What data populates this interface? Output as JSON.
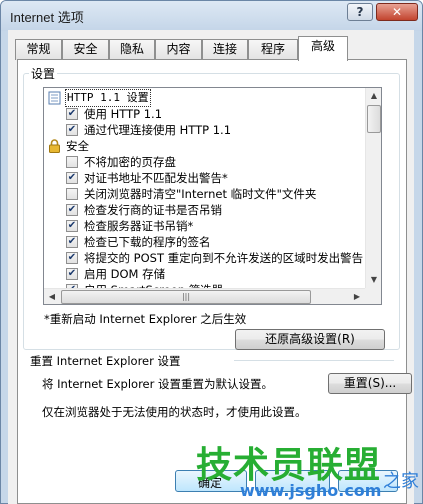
{
  "window": {
    "title": "Internet 选项",
    "help_label": "?",
    "close_label": "✕"
  },
  "tabs": [
    {
      "label": "常规"
    },
    {
      "label": "安全"
    },
    {
      "label": "隐私"
    },
    {
      "label": "内容"
    },
    {
      "label": "连接"
    },
    {
      "label": "程序"
    },
    {
      "label": "高级",
      "active": true
    }
  ],
  "settings": {
    "group_label": "设置",
    "items": [
      {
        "text": "HTTP 1.1 设置",
        "kind": "header-icon",
        "selected": true
      },
      {
        "text": "使用 HTTP 1.1",
        "kind": "checkbox",
        "checked": true
      },
      {
        "text": "通过代理连接使用 HTTP 1.1",
        "kind": "checkbox",
        "checked": true
      },
      {
        "text": "安全",
        "kind": "category-lock"
      },
      {
        "text": "不将加密的页存盘",
        "kind": "checkbox",
        "checked": false
      },
      {
        "text": "对证书地址不匹配发出警告*",
        "kind": "checkbox",
        "checked": true
      },
      {
        "text": "关闭浏览器时清空\"Internet 临时文件\"文件夹",
        "kind": "checkbox",
        "checked": false
      },
      {
        "text": "检查发行商的证书是否吊销",
        "kind": "checkbox",
        "checked": true
      },
      {
        "text": "检查服务器证书吊销*",
        "kind": "checkbox",
        "checked": true
      },
      {
        "text": "检查已下载的程序的签名",
        "kind": "checkbox",
        "checked": true
      },
      {
        "text": "将提交的 POST 重定向到不允许发送的区域时发出警告",
        "kind": "checkbox",
        "checked": true
      },
      {
        "text": "启用 DOM 存储",
        "kind": "checkbox",
        "checked": true
      },
      {
        "text": "启用 SmartScreen 筛选器",
        "kind": "checkbox",
        "checked": true
      }
    ],
    "restart_note": "*重新启动 Internet Explorer 之后生效",
    "restore_button": "还原高级设置(R)"
  },
  "reset": {
    "heading": "重置 Internet Explorer 设置",
    "description": "将 Internet Explorer 设置重置为默认设置。",
    "button": "重置(S)...",
    "note": "仅在浏览器处于无法使用的状态时，才使用此设置。"
  },
  "bottom": {
    "ok_partial": "确定",
    "watermark_title": "技术员联盟",
    "watermark_url": "www.jsgho.com",
    "watermark_tail": "之家"
  },
  "colors": {
    "accent": "#3c7fb1",
    "watermark_green": "#27ae33",
    "watermark_blue": "#2f7fd8"
  }
}
